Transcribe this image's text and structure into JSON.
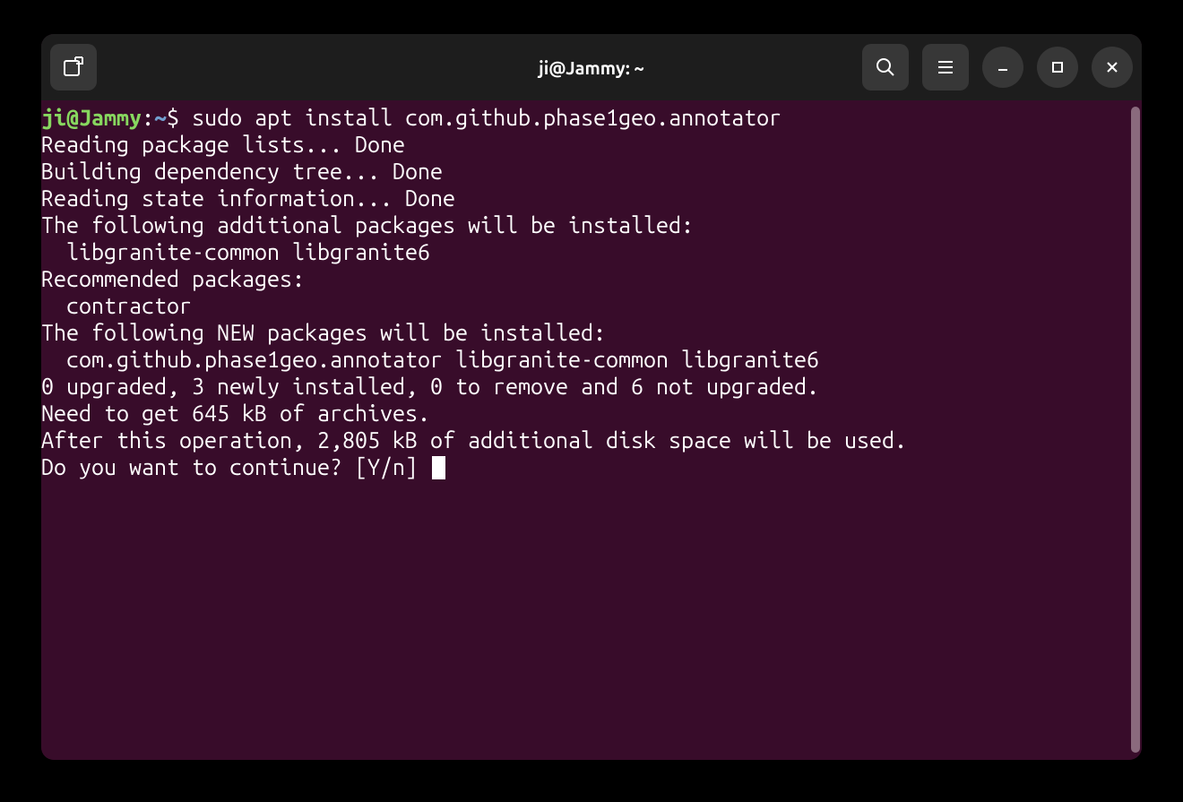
{
  "window": {
    "title": "ji@Jammy: ~"
  },
  "prompt": {
    "user_host": "ji@Jammy",
    "separator": ":",
    "path": "~",
    "symbol": "$"
  },
  "command": "sudo apt install com.github.phase1geo.annotator",
  "output": {
    "l1": "Reading package lists... Done",
    "l2": "Building dependency tree... Done",
    "l3": "Reading state information... Done",
    "l4": "The following additional packages will be installed:",
    "l5": "  libgranite-common libgranite6",
    "l6": "Recommended packages:",
    "l7": "  contractor",
    "l8": "The following NEW packages will be installed:",
    "l9": "  com.github.phase1geo.annotator libgranite-common libgranite6",
    "l10": "0 upgraded, 3 newly installed, 0 to remove and 6 not upgraded.",
    "l11": "Need to get 645 kB of archives.",
    "l12": "After this operation, 2,805 kB of additional disk space will be used.",
    "l13": "Do you want to continue? [Y/n] "
  }
}
